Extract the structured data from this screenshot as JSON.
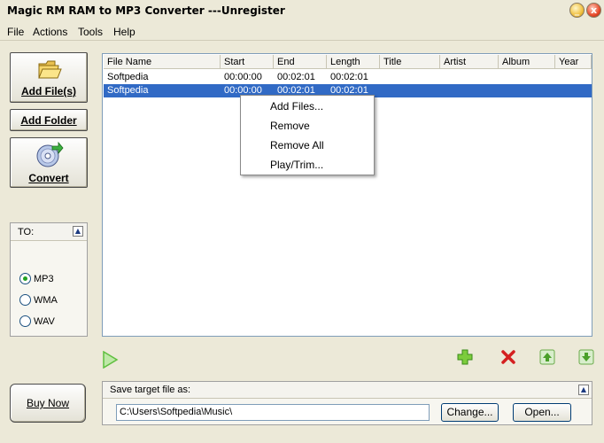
{
  "window": {
    "title": "Magic RM RAM to MP3 Converter ---Unregister",
    "minimize": "_",
    "close": "x"
  },
  "menu": [
    "File",
    "Actions",
    "Tools",
    "Help"
  ],
  "buttons": {
    "add_files": "Add File(s)",
    "add_folder": "Add Folder",
    "convert": "Convert",
    "buy_now": "Buy Now"
  },
  "to_panel": {
    "title": "TO:",
    "options": [
      "MP3",
      "WMA",
      "WAV"
    ],
    "selected": "MP3"
  },
  "file_list": {
    "columns": [
      "File Name",
      "Start",
      "End",
      "Length",
      "Title",
      "Artist",
      "Album",
      "Year"
    ],
    "rows": [
      {
        "name": "Softpedia",
        "start": "00:00:00",
        "end": "00:02:01",
        "length": "00:02:01"
      },
      {
        "name": "Softpedia",
        "start": "00:00:00",
        "end": "00:02:01",
        "length": "00:02:01"
      }
    ],
    "selected_row": 2
  },
  "context_menu": [
    "Add Files...",
    "Remove",
    "Remove All",
    "Play/Trim..."
  ],
  "save": {
    "title": "Save target file as:",
    "path": "C:\\Users\\Softpedia\\Music\\",
    "change_label": "Change...",
    "open_label": "Open..."
  },
  "colors": {
    "selection": "#316ac5",
    "window_bg": "#ece9d8",
    "play_green": "#5fbf3f",
    "remove_red": "#d42020"
  }
}
